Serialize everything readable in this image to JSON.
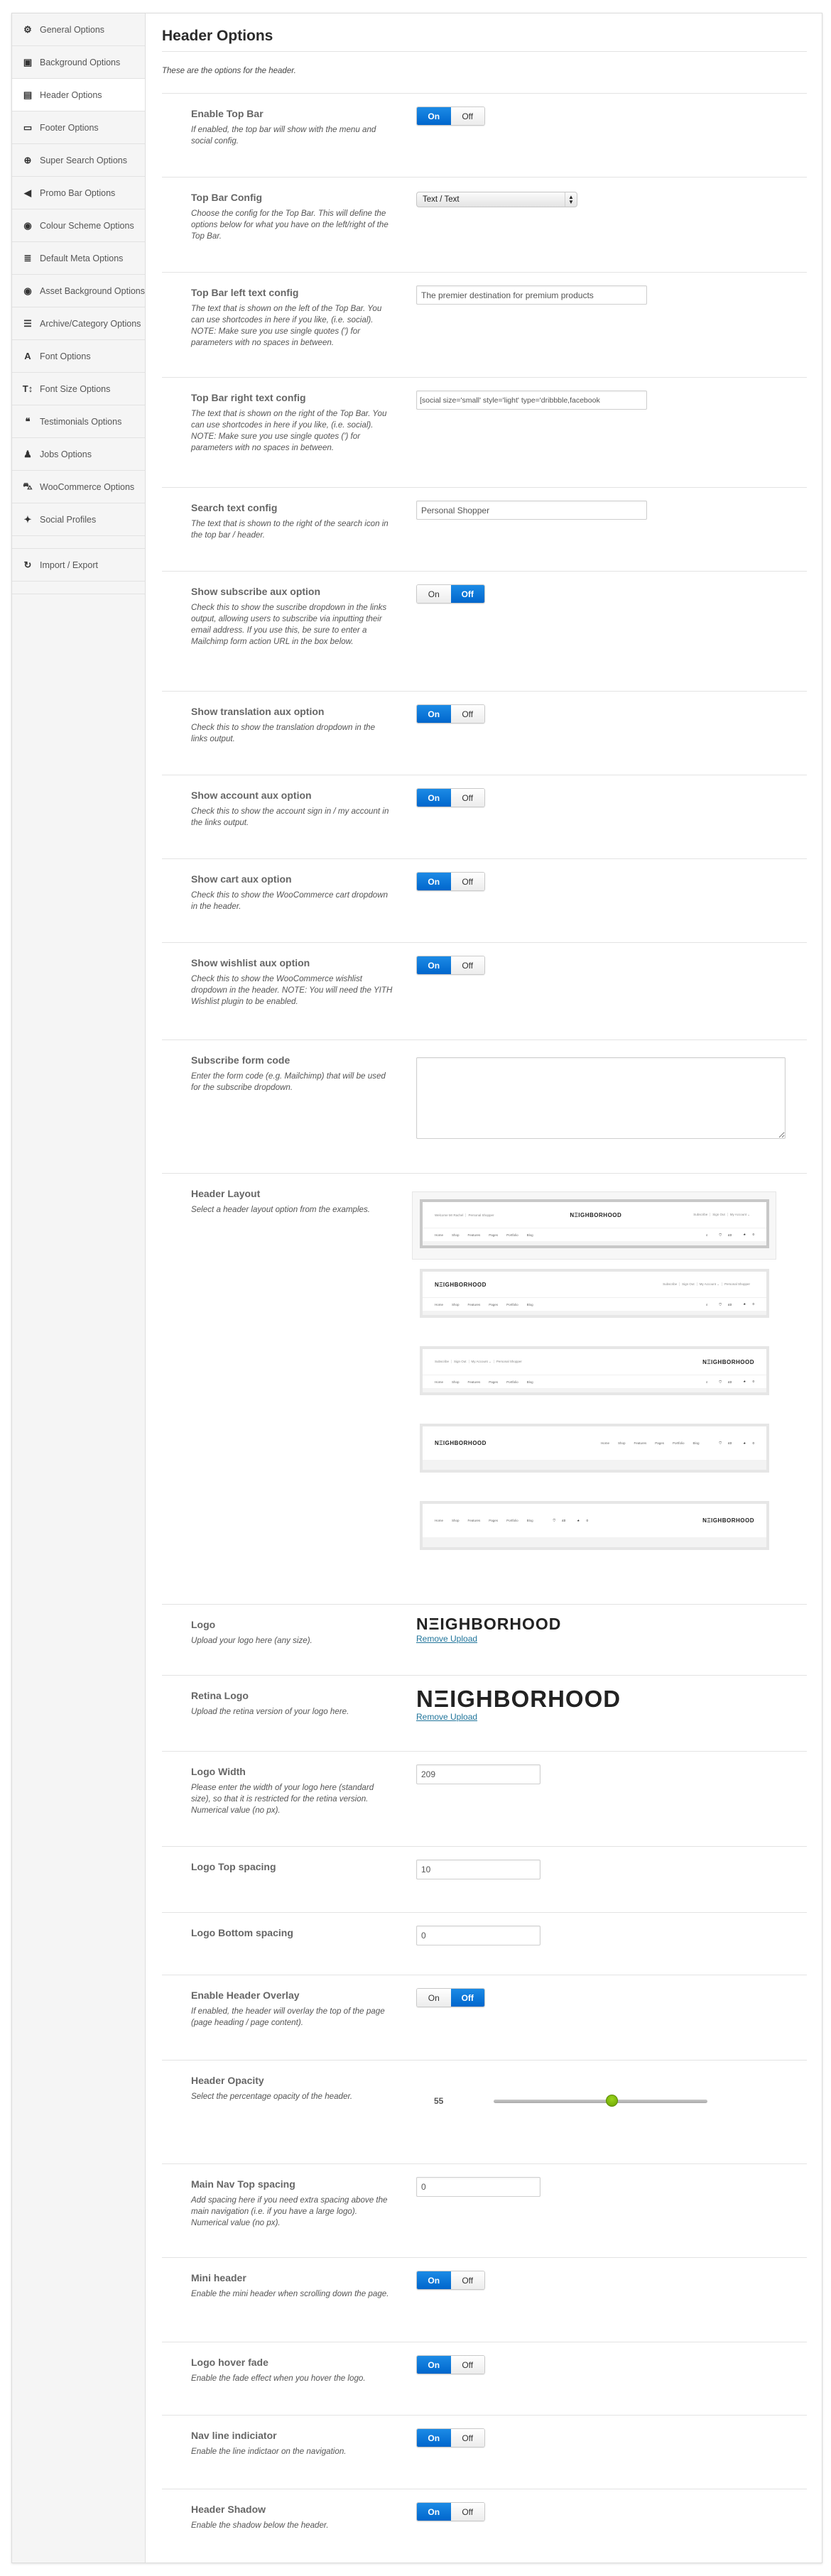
{
  "sidebar": {
    "items": [
      {
        "label": "General Options",
        "icon": "gear-icon",
        "glyph": "⚙"
      },
      {
        "label": "Background Options",
        "icon": "image-icon",
        "glyph": "▣"
      },
      {
        "label": "Header Options",
        "icon": "header-icon",
        "glyph": "▤",
        "active": true
      },
      {
        "label": "Footer Options",
        "icon": "footer-icon",
        "glyph": "▭"
      },
      {
        "label": "Super Search Options",
        "icon": "zoom-in-icon",
        "glyph": "⊕"
      },
      {
        "label": "Promo Bar Options",
        "icon": "bullhorn-icon",
        "glyph": "◀"
      },
      {
        "label": "Colour Scheme Options",
        "icon": "eye-icon",
        "glyph": "◉"
      },
      {
        "label": "Default Meta Options",
        "icon": "tasks-icon",
        "glyph": "≣"
      },
      {
        "label": "Asset Background Options",
        "icon": "eye-icon",
        "glyph": "◉"
      },
      {
        "label": "Archive/Category Options",
        "icon": "list-icon",
        "glyph": "☰"
      },
      {
        "label": "Font Options",
        "icon": "font-icon",
        "glyph": "A"
      },
      {
        "label": "Font Size Options",
        "icon": "text-height-icon",
        "glyph": "T↕"
      },
      {
        "label": "Testimonials Options",
        "icon": "quote-icon",
        "glyph": "❝"
      },
      {
        "label": "Jobs Options",
        "icon": "user-icon",
        "glyph": "♟"
      },
      {
        "label": "WooCommerce Options",
        "icon": "cart-icon",
        "glyph": "⛍"
      },
      {
        "label": "Social Profiles",
        "icon": "twitter-icon",
        "glyph": "✦"
      },
      {
        "spacer": true
      },
      {
        "label": "Import / Export",
        "icon": "refresh-icon",
        "glyph": "↻"
      },
      {
        "spacer": true
      }
    ]
  },
  "page": {
    "title": "Header Options",
    "description": "These are the options for the header."
  },
  "toggle_labels": {
    "on": "On",
    "off": "Off"
  },
  "remove_upload_label": "Remove Upload",
  "rows": [
    {
      "id": "enable-top-bar",
      "label": "Enable Top Bar",
      "desc": "If enabled, the top bar will show with the menu and social config.",
      "type": "toggle",
      "value": "on"
    },
    {
      "id": "top-bar-config",
      "label": "Top Bar Config",
      "desc": "Choose the config for the Top Bar. This will define the options below for what you have on the left/right of the Top Bar.",
      "type": "select",
      "value": "Text / Text"
    },
    {
      "id": "top-bar-left-text",
      "label": "Top Bar left text config",
      "desc": "The text that is shown on the left of the Top Bar. You can use shortcodes in here if you like, (i.e. social). NOTE: Make sure you use single quotes (') for parameters with no spaces in between.",
      "type": "text",
      "value": "The premier destination for premium products"
    },
    {
      "id": "top-bar-right-text",
      "label": "Top Bar right text config",
      "desc": "The text that is shown on the right of the Top Bar. You can use shortcodes in here if you like, (i.e. social). NOTE: Make sure you use single quotes (') for parameters with no spaces in between.",
      "type": "text",
      "value": "[social size='small' style='light' type='dribbble,facebook"
    },
    {
      "id": "search-text",
      "label": "Search text config",
      "desc": "The text that is shown to the right of the search icon in the top bar / header.",
      "type": "text",
      "value": "Personal Shopper"
    },
    {
      "id": "show-subscribe-aux",
      "label": "Show subscribe aux option",
      "desc": "Check this to show the suscribe dropdown in the links output, allowing users to subscribe via inputting their email address. If you use this, be sure to enter a Mailchimp form action URL in the box below.",
      "type": "toggle",
      "value": "off"
    },
    {
      "id": "show-translation-aux",
      "label": "Show translation aux option",
      "desc": "Check this to show the translation dropdown in the links output.",
      "type": "toggle",
      "value": "on"
    },
    {
      "id": "show-account-aux",
      "label": "Show account aux option",
      "desc": "Check this to show the account sign in / my account in the links output.",
      "type": "toggle",
      "value": "on"
    },
    {
      "id": "show-cart-aux",
      "label": "Show cart aux option",
      "desc": "Check this to show the WooCommerce cart dropdown in the header.",
      "type": "toggle",
      "value": "on"
    },
    {
      "id": "show-wishlist-aux",
      "label": "Show wishlist aux option",
      "desc": "Check this to show the WooCommerce wishlist dropdown in the header. NOTE: You will need the YITH Wishlist plugin to be enabled.",
      "type": "toggle",
      "value": "on"
    },
    {
      "id": "subscribe-form-code",
      "label": "Subscribe form code",
      "desc": "Enter the form code (e.g. Mailchimp) that will be used for the subscribe dropdown.",
      "type": "textarea",
      "value": ""
    },
    {
      "id": "header-layout",
      "label": "Header Layout",
      "desc": "Select a header layout option from the examples.",
      "type": "layouts",
      "selected": 1
    },
    {
      "id": "logo",
      "label": "Logo",
      "desc": "Upload your logo here (any size).",
      "type": "logo",
      "value": "NΞIGHBORHOOD",
      "size": "std"
    },
    {
      "id": "retina-logo",
      "label": "Retina Logo",
      "desc": "Upload the retina version of your logo here.",
      "type": "logo",
      "value": "NΞIGHBORHOOD",
      "size": "ret"
    },
    {
      "id": "logo-width",
      "label": "Logo Width",
      "desc": "Please enter the width of your logo here (standard size), so that it is restricted for the retina version. Numerical value (no px).",
      "type": "small",
      "value": "209"
    },
    {
      "id": "logo-top-spacing",
      "label": "Logo Top spacing",
      "desc": "",
      "type": "small",
      "value": "10"
    },
    {
      "id": "logo-bottom-spacing",
      "label": "Logo Bottom spacing",
      "desc": "",
      "type": "small",
      "value": "0"
    },
    {
      "id": "enable-header-overlay",
      "label": "Enable Header Overlay",
      "desc": "If enabled, the header will overlay the top of the page (page heading / page content).",
      "type": "toggle",
      "value": "off"
    },
    {
      "id": "header-opacity",
      "label": "Header Opacity",
      "desc": "Select the percentage opacity of the header.",
      "type": "slider",
      "value": "55",
      "min": 0,
      "max": 100
    },
    {
      "id": "main-nav-top-spacing",
      "label": "Main Nav Top spacing",
      "desc": "Add spacing here if you need extra spacing above the main navigation (i.e. if you have a large logo). Numerical value (no px).",
      "type": "small",
      "value": "0"
    },
    {
      "id": "mini-header",
      "label": "Mini header",
      "desc": "Enable the mini header when scrolling down the page.",
      "type": "toggle",
      "value": "on"
    },
    {
      "id": "logo-hover-fade",
      "label": "Logo hover fade",
      "desc": "Enable the fade effect when you hover the logo.",
      "type": "toggle",
      "value": "on"
    },
    {
      "id": "nav-line-indicator",
      "label": "Nav line indiciator",
      "desc": "Enable the line indictaor on the navigation.",
      "type": "toggle",
      "value": "on"
    },
    {
      "id": "header-shadow",
      "label": "Header Shadow",
      "desc": "Enable the shadow below the header.",
      "type": "toggle",
      "value": "on"
    }
  ],
  "layout_thumbs": {
    "logo": "NΞIGHBORHOOD",
    "nav": [
      "Home",
      "Shop",
      "Features",
      "Pages",
      "Portfolio",
      "Blog"
    ],
    "cart": "£0",
    "wishlist": "0",
    "search_glyph": "⌕",
    "welcome_links": [
      "Welcome Mr Rachel",
      "Personal Shopper"
    ],
    "account_links_short": [
      "Subscribe",
      "Sign Out",
      "My Account ⌄"
    ],
    "account_links_full": [
      "Subscribe",
      "Sign Out",
      "My Account ⌄",
      "Personal Shopper"
    ],
    "variants": [
      "centered-logo-topbar",
      "logo-left-topbar",
      "logo-right-topbar",
      "logo-left-inline-nav",
      "nav-left-logo-right"
    ]
  },
  "colors": {
    "accent": "#0066cc",
    "slider_knob": "#7ab800",
    "link": "#21759b"
  }
}
